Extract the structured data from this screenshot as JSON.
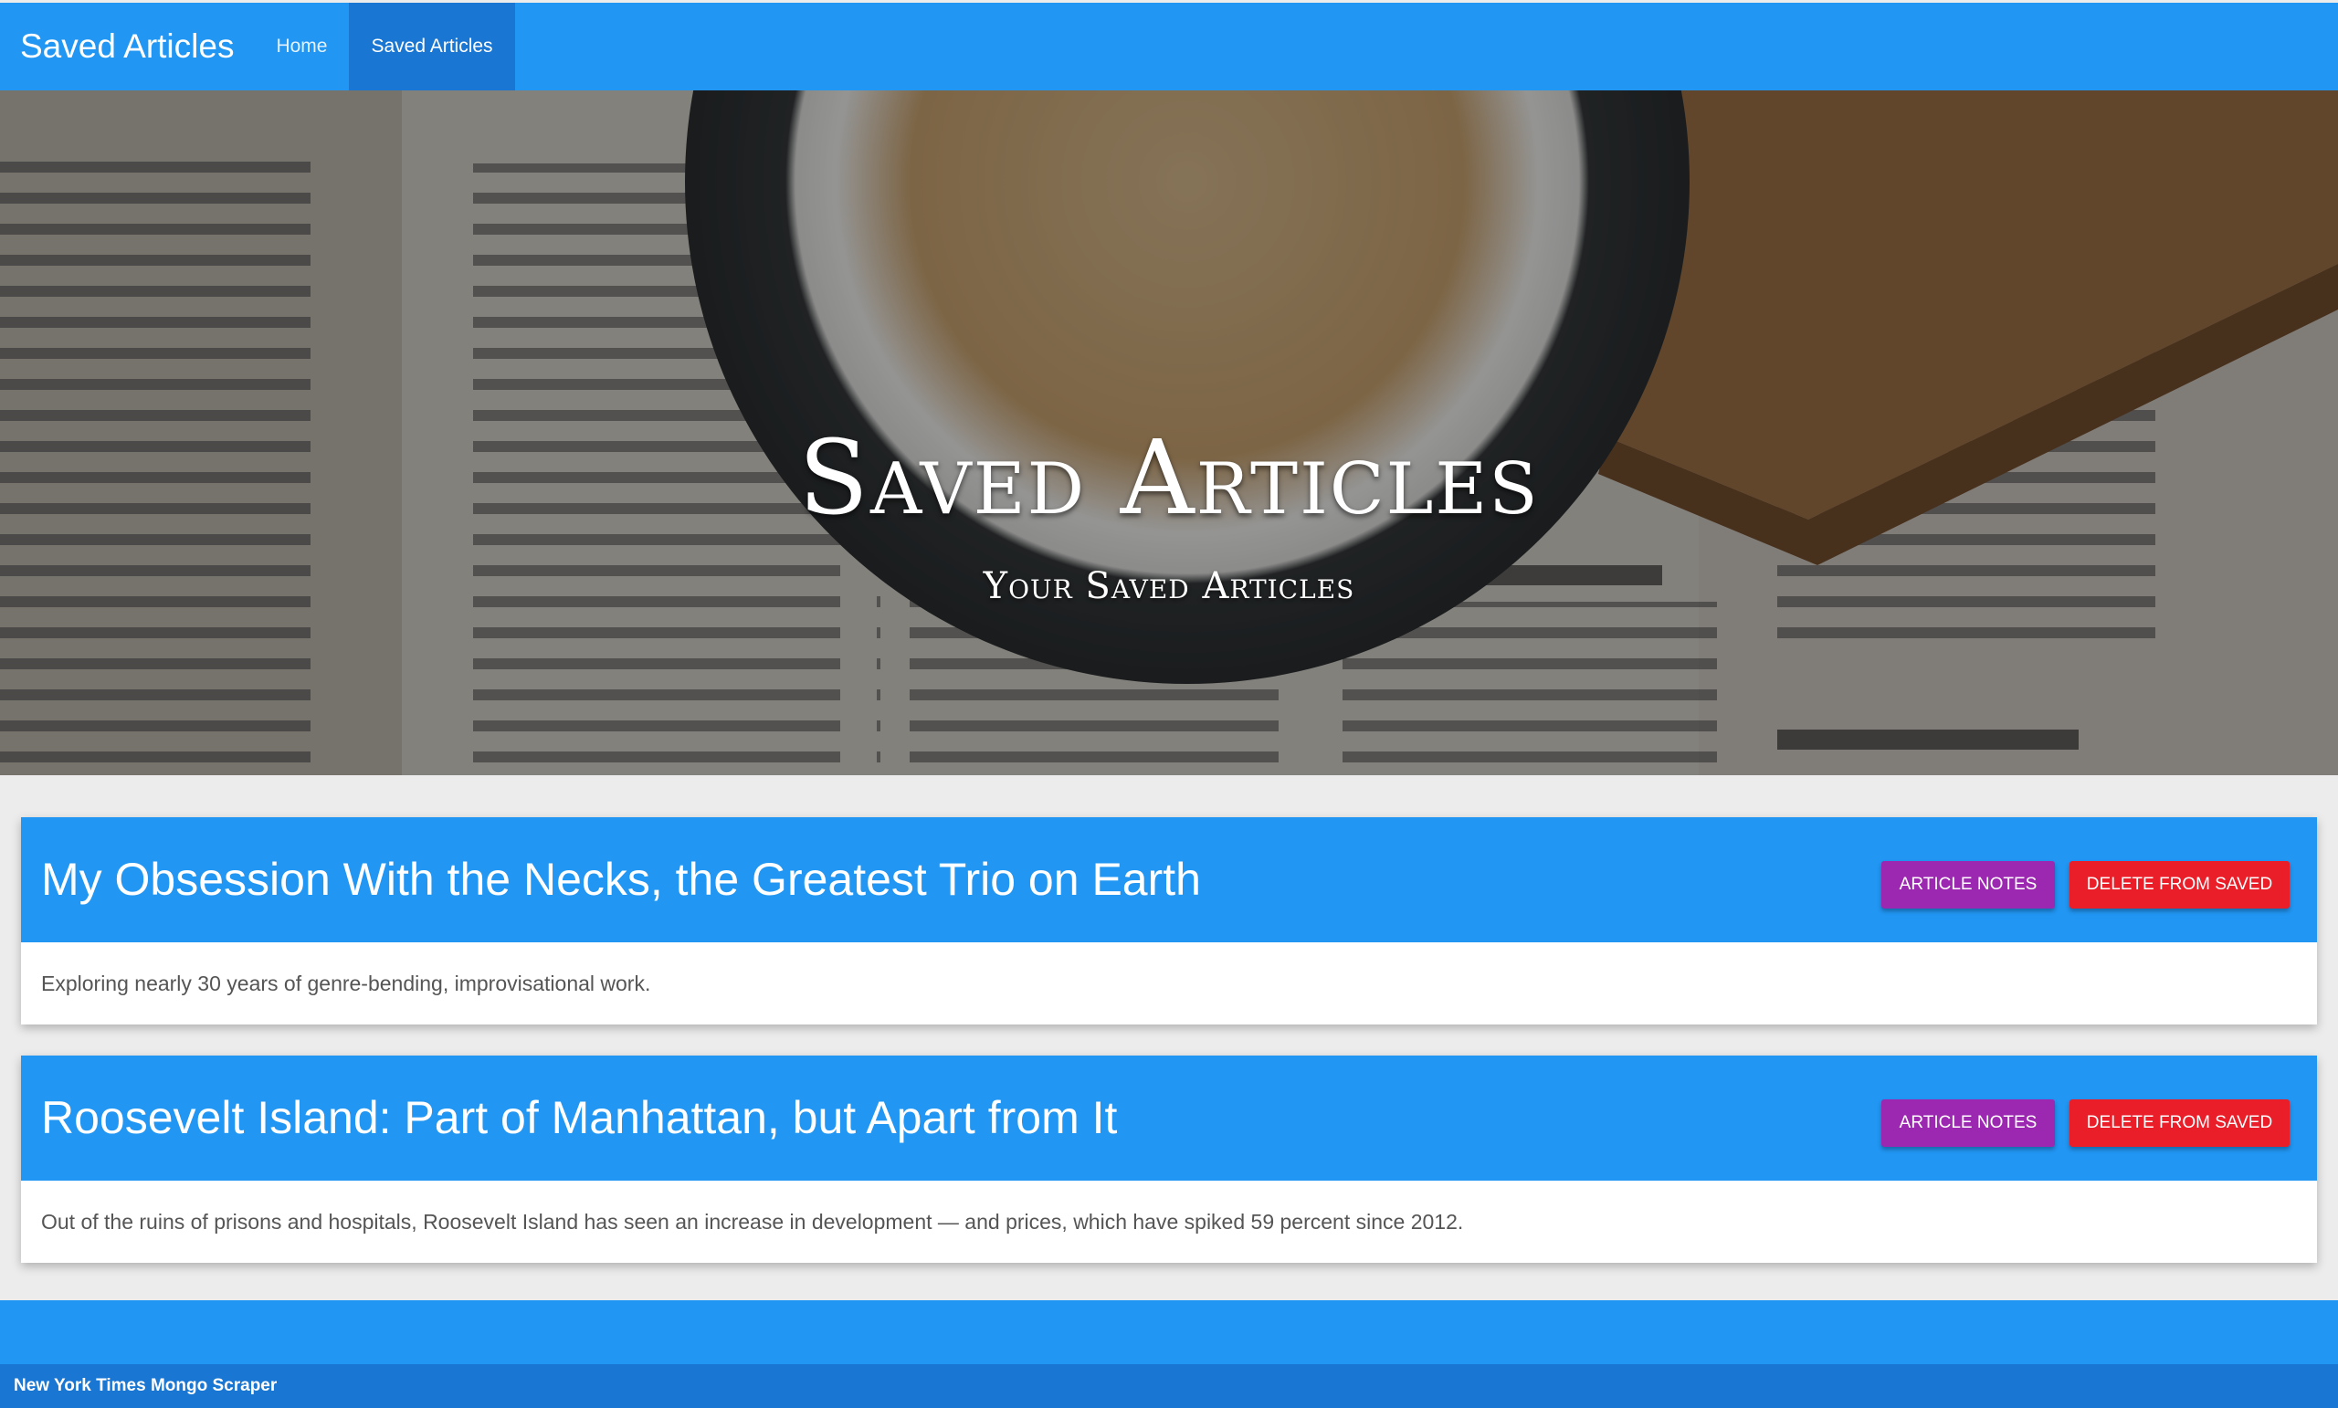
{
  "navbar": {
    "brand": "Saved Articles",
    "links": [
      {
        "label": "Home",
        "active": false
      },
      {
        "label": "Saved Articles",
        "active": true
      }
    ]
  },
  "hero": {
    "title": "Saved Articles",
    "subtitle": "Your Saved Articles"
  },
  "articles": [
    {
      "title": "My Obsession With the Necks, the Greatest Trio on Earth",
      "summary": "Exploring nearly 30 years of genre-bending, improvisational work.",
      "notes_label": "Article Notes",
      "delete_label": "Delete From Saved"
    },
    {
      "title": "Roosevelt Island: Part of Manhattan, but Apart from It",
      "summary": "Out of the ruins of prisons and hospitals, Roosevelt Island has seen an increase in development — and prices, which have spiked 59 percent since 2012.",
      "notes_label": "Article Notes",
      "delete_label": "Delete From Saved"
    }
  ],
  "footer": {
    "text": "New York Times Mongo Scraper"
  },
  "colors": {
    "primary": "#2196f3",
    "primary_dark": "#1976d2",
    "notes_button": "#9c27b0",
    "delete_button": "#e91e28"
  }
}
